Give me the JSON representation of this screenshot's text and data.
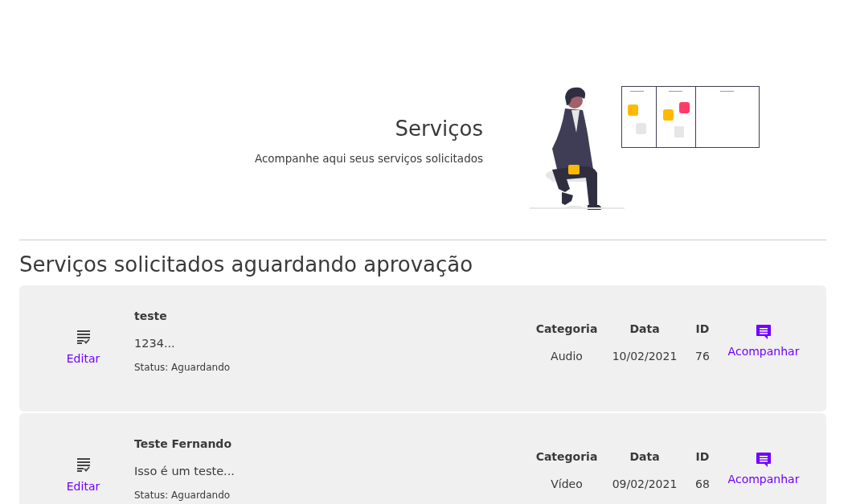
{
  "hero": {
    "title": "Serviços",
    "subtitle": "Acompanhe aqui seus serviços solicitados"
  },
  "section": {
    "title": "Serviços solicitados aguardando aprovação"
  },
  "services": [
    {
      "edit_label": "Editar",
      "name": "teste",
      "description": "1234...",
      "status": "Status: Aguardando",
      "category_label": "Categoria",
      "category": "Audio",
      "date_label": "Data",
      "date": "10/02/2021",
      "id_label": "ID",
      "id": "76",
      "follow_label": "Acompanhar"
    },
    {
      "edit_label": "Editar",
      "name": "Teste Fernando",
      "description": "Isso é um teste...",
      "status": "Status: Aguardando",
      "category_label": "Categoria",
      "category": "Vídeo",
      "date_label": "Data",
      "date": "09/02/2021",
      "id_label": "ID",
      "id": "68",
      "follow_label": "Acompanhar"
    }
  ]
}
